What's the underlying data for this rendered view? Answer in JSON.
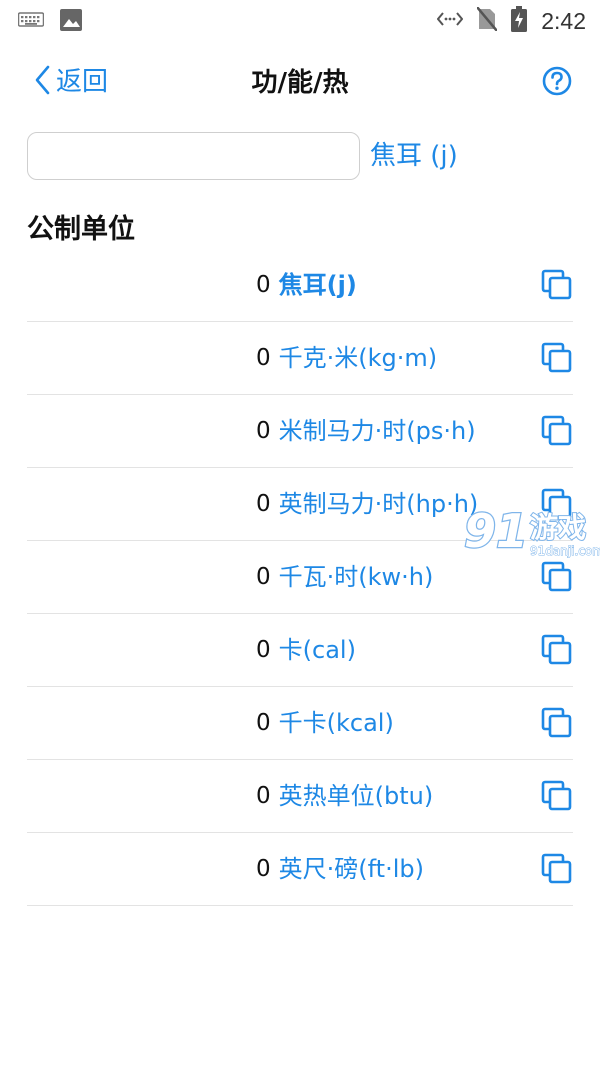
{
  "status_bar": {
    "time": "2:42",
    "icons": [
      "keyboard-icon",
      "image-icon",
      "data-transfer-icon",
      "no-sim-icon",
      "battery-charging-icon"
    ]
  },
  "nav": {
    "back_label": "返回",
    "title": "功/能/热",
    "help_icon": "help-icon"
  },
  "input": {
    "value": "",
    "placeholder": "",
    "unit_label": "焦耳 (j)"
  },
  "section": {
    "title": "公制单位"
  },
  "units": [
    {
      "value": "0",
      "label": "焦耳(j)",
      "selected": true
    },
    {
      "value": "0",
      "label": "千克·米(kg·m)",
      "selected": false
    },
    {
      "value": "0",
      "label": "米制马力·时(ps·h)",
      "selected": false
    },
    {
      "value": "0",
      "label": "英制马力·时(hp·h)",
      "selected": false
    },
    {
      "value": "0",
      "label": "千瓦·时(kw·h)",
      "selected": false
    },
    {
      "value": "0",
      "label": "卡(cal)",
      "selected": false
    },
    {
      "value": "0",
      "label": "千卡(kcal)",
      "selected": false
    },
    {
      "value": "0",
      "label": "英热单位(btu)",
      "selected": false
    },
    {
      "value": "0",
      "label": "英尺·磅(ft·lb)",
      "selected": false
    }
  ],
  "watermark": {
    "brand": "91游戏",
    "url": "91danji.com"
  },
  "colors": {
    "accent": "#1e88e5",
    "text": "#111111",
    "divider": "#e3e3e3"
  }
}
